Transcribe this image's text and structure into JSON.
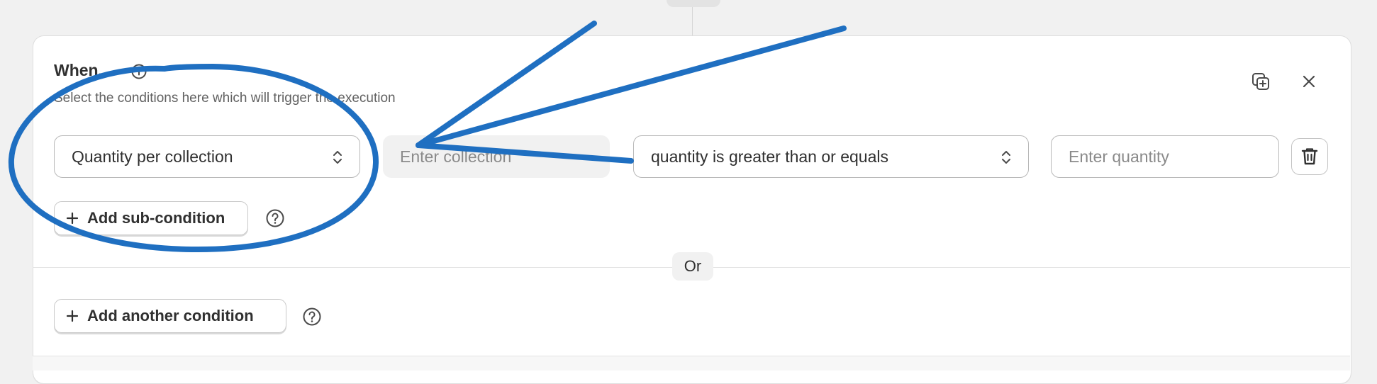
{
  "card": {
    "title": "When.",
    "subtitle": "Select the conditions here which will trigger the execution"
  },
  "condition": {
    "type_value": "Quantity per collection",
    "collection_placeholder": "Enter collection",
    "operator_value": "quantity is greater than or equals",
    "quantity_placeholder": "Enter quantity"
  },
  "buttons": {
    "add_sub_condition": "Add sub-condition",
    "add_another_condition": "Add another condition"
  },
  "divider_label": "Or",
  "icons": {
    "info": "info-icon",
    "duplicate": "duplicate-icon",
    "close": "close-icon",
    "chevron": "select-chevron-icon",
    "delete": "trash-icon",
    "plus": "plus-icon",
    "help": "help-icon"
  },
  "colors": {
    "annotation_blue": "#1f6fc1",
    "text": "#303030",
    "muted": "#616161",
    "placeholder": "#8a8a8a"
  }
}
